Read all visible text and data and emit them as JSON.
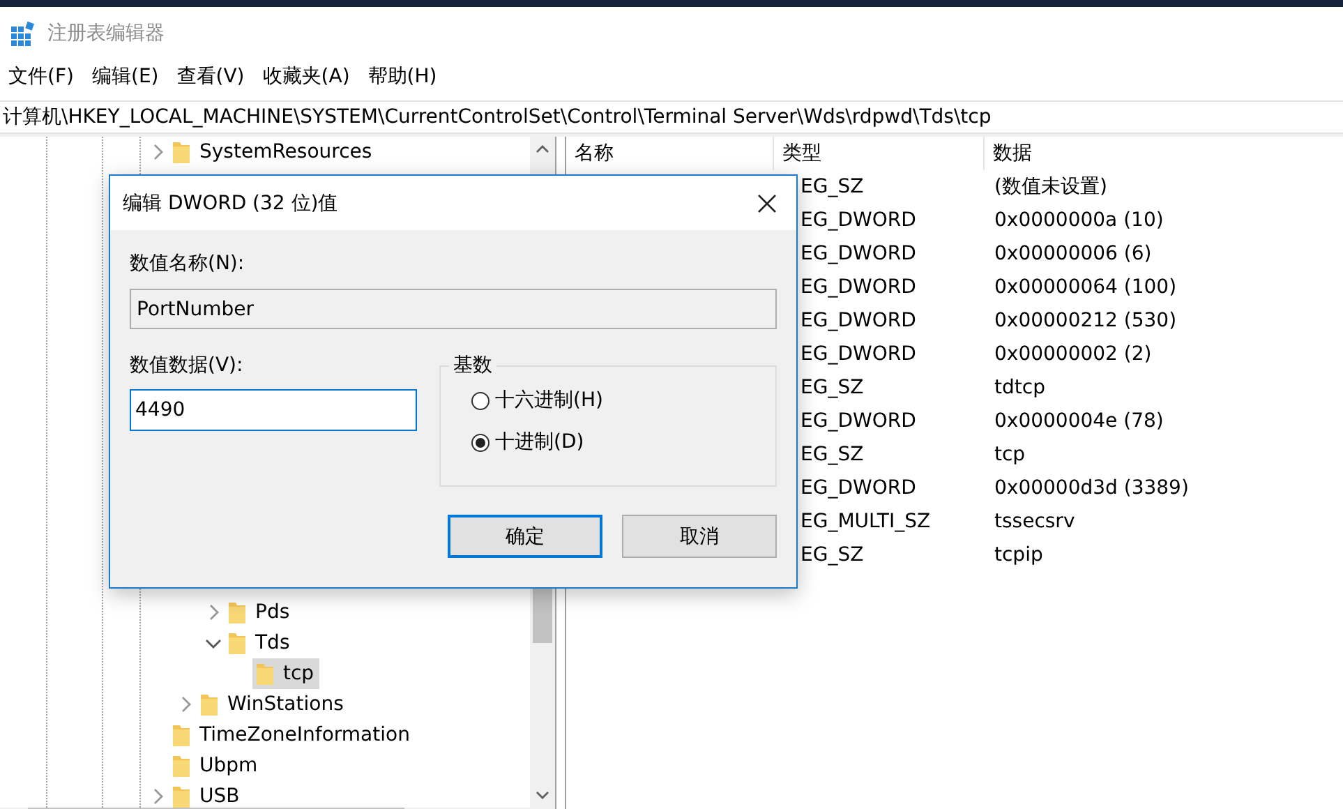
{
  "window": {
    "title": "注册表编辑器"
  },
  "menu": [
    "文件(F)",
    "编辑(E)",
    "查看(V)",
    "收藏夹(A)",
    "帮助(H)"
  ],
  "address": "计算机\\HKEY_LOCAL_MACHINE\\SYSTEM\\CurrentControlSet\\Control\\Terminal Server\\Wds\\rdpwd\\Tds\\tcp",
  "tree": {
    "items": [
      {
        "label": "SystemResources",
        "expanded": false,
        "selected": false
      },
      {
        "children": [
          {
            "children": [
              {
                "label": "Pds",
                "expanded": false,
                "selected": false
              },
              {
                "label": "Tds",
                "expanded": true,
                "selected": false,
                "children": [
                  {
                    "label": "tcp",
                    "selected": true
                  }
                ]
              }
            ]
          },
          {
            "label": "WinStations",
            "expanded": false,
            "selected": false
          }
        ]
      },
      {
        "label": "TimeZoneInformation",
        "selected": false
      },
      {
        "label": "Ubpm",
        "selected": false
      },
      {
        "label": "USB",
        "expanded": false,
        "selected": false
      }
    ]
  },
  "list": {
    "columns": [
      "名称",
      "类型",
      "数据"
    ],
    "rows": [
      {
        "type": "EG_SZ",
        "data": "(数值未设置)"
      },
      {
        "type": "EG_DWORD",
        "data": "0x0000000a (10)"
      },
      {
        "type": "EG_DWORD",
        "data": "0x00000006 (6)"
      },
      {
        "type": "EG_DWORD",
        "data": "0x00000064 (100)"
      },
      {
        "type": "EG_DWORD",
        "data": "0x00000212 (530)"
      },
      {
        "type": "EG_DWORD",
        "data": "0x00000002 (2)"
      },
      {
        "type": "EG_SZ",
        "data": "tdtcp"
      },
      {
        "type": "EG_DWORD",
        "data": "0x0000004e (78)"
      },
      {
        "type": "EG_SZ",
        "data": "tcp"
      },
      {
        "type": "EG_DWORD",
        "data": "0x00000d3d (3389)"
      },
      {
        "type": "EG_MULTI_SZ",
        "data": "tssecsrv"
      },
      {
        "type": "EG_SZ",
        "data": "tcpip"
      }
    ]
  },
  "dialog": {
    "title": "编辑 DWORD (32 位)值",
    "name_label": "数值名称(N):",
    "name_value": "PortNumber",
    "data_label": "数值数据(V):",
    "data_value": "4490",
    "base_label": "基数",
    "bases": [
      {
        "label": "十六进制(H)",
        "selected": false
      },
      {
        "label": "十进制(D)",
        "selected": true
      }
    ],
    "buttons": [
      {
        "label": "确定",
        "default": true
      },
      {
        "label": "取消",
        "default": false
      }
    ]
  }
}
